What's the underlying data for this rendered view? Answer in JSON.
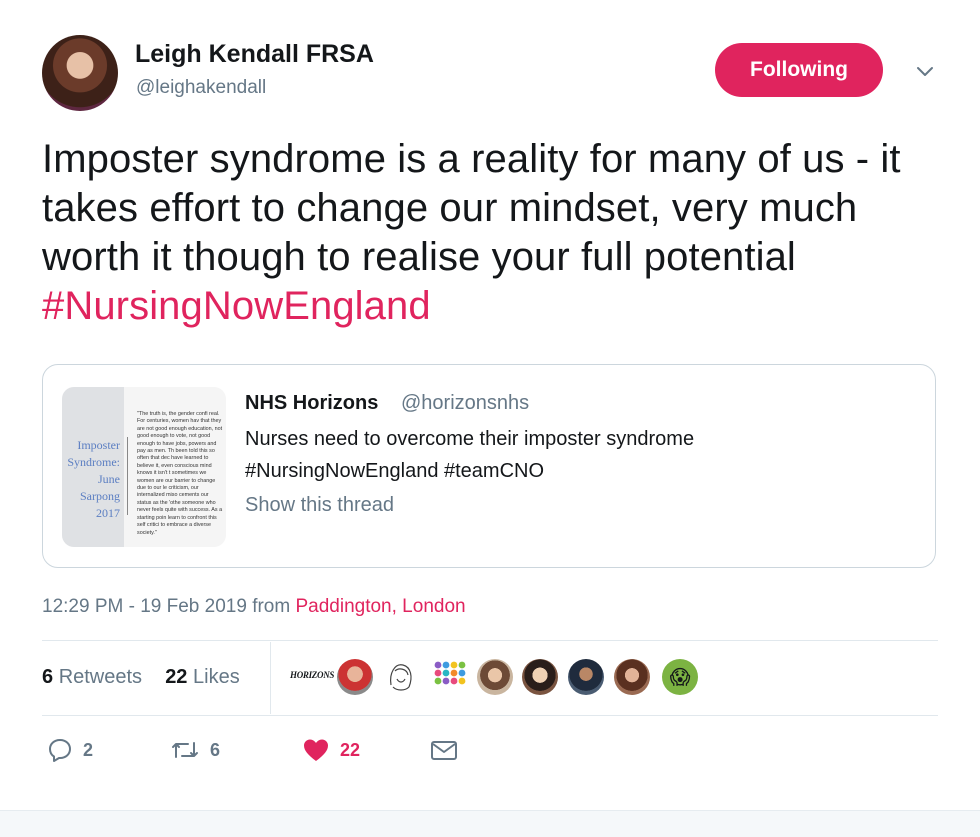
{
  "author": {
    "display_name": "Leigh Kendall FRSA",
    "handle": "@leighakendall"
  },
  "follow_button_label": "Following",
  "tweet": {
    "text": "Imposter syndrome is a reality for many of us - it takes effort to change our mindset, very much worth it though to realise your full potential ",
    "hashtag": "#NursingNowEngland"
  },
  "quote": {
    "name": "NHS Horizons",
    "handle": "@horizonsnhs",
    "text_line1": "Nurses need to overcome their imposter syndrome",
    "text_line2": "#NursingNowEngland #teamCNO",
    "show_thread": "Show this thread",
    "thumbnail": {
      "title_lines": [
        "Imposter",
        "Syndrome:",
        "June",
        "Sarpong",
        "2017"
      ],
      "quote_text": "\"The truth is, the gender confi real. For centuries, women hav that they are not good enough education, not good enough to vote, not good enough to have jobs, powers and pay as men. Th been told this so often that dec have learned to believe it, even conscious mind knows it isn't t sometimes we women are our barrier to change due to our le criticism, our internalized miso cements our status as the 'othe someone who never feels quite with success. As a starting poin learn to confront this self critici to embrace a diverse society.\""
    }
  },
  "meta": {
    "time": "12:29 PM - 19 Feb 2019",
    "from_label": " from ",
    "location": "Paddington, London"
  },
  "stats": {
    "retweets_count": "6",
    "retweets_label": "Retweets",
    "likes_count": "22",
    "likes_label": "Likes",
    "liker_logo_text": "HORIZONS"
  },
  "actions": {
    "reply_count": "2",
    "retweet_count": "6",
    "like_count": "22"
  },
  "colors": {
    "accent": "#e0245e",
    "secondary_text": "#657786",
    "primary_text": "#14171a",
    "border": "#ccd6dd"
  }
}
